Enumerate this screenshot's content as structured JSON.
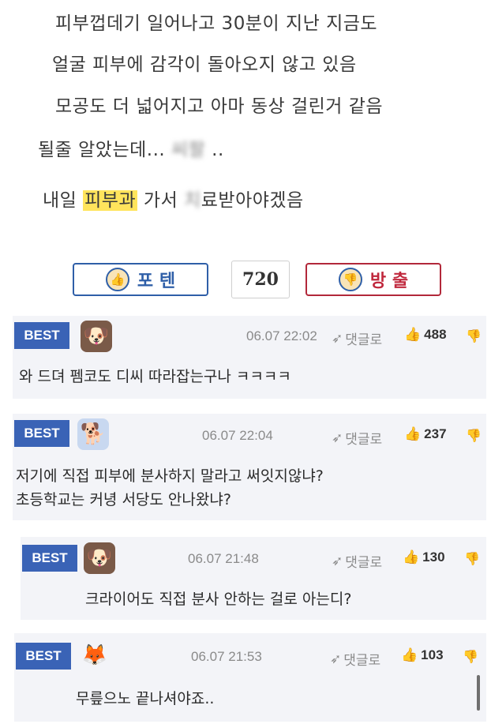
{
  "post": {
    "line1": "피부껍데기 일어나고  30분이 지난 지금도",
    "line2": "얼굴 피부에 감각이 돌아오지 않고 있음",
    "line3": "모공도 더 넓어지고 아마 동상 걸린거 같음",
    "line4_a": "될줄 알았는데... ",
    "line4_blur": "씨팔",
    "line4_b": " ..",
    "line5_a": "내일 ",
    "line5_hl": "피부과",
    "line5_b": " 가서 ",
    "line5_blur": "치",
    "line5_c": "료받아야겠음"
  },
  "votes": {
    "up_label": "포 텐",
    "count": "720",
    "down_label": "방 출"
  },
  "comments": [
    {
      "badge": "BEST",
      "avatar_icon": "dog-icon",
      "time": "06.07 22:02",
      "reply_label": "댓글로",
      "likes": "488",
      "text_lines": [
        "와 드뎌 펨코도 디씨 따라잡는구나 ㅋㅋㅋㅋ"
      ]
    },
    {
      "badge": "BEST",
      "avatar_icon": "white-dog-icon",
      "time": "06.07 22:04",
      "reply_label": "댓글로",
      "likes": "237",
      "text_lines": [
        "저기에 직접 피부에 분사하지 말라고 써잇지않냐?",
        "초등학교는 커녕 서당도 안나왔냐?"
      ]
    },
    {
      "badge": "BEST",
      "avatar_icon": "dog-icon",
      "time": "06.07 21:48",
      "reply_label": "댓글로",
      "likes": "130",
      "text_lines": [
        "크라이어도 직접 분사 안하는 걸로 아는디?"
      ]
    },
    {
      "badge": "BEST",
      "avatar_icon": "fox-icon",
      "time": "06.07 21:53",
      "reply_label": "댓글로",
      "likes": "103",
      "text_lines": [
        "무릎으노 끝나셔야죠.."
      ]
    }
  ],
  "colors": {
    "badge": "#3a63b6",
    "highlight": "#ffe45c",
    "up": "#2f5fa8",
    "down": "#b2283a",
    "comment_bg": "#f3f4f8"
  }
}
